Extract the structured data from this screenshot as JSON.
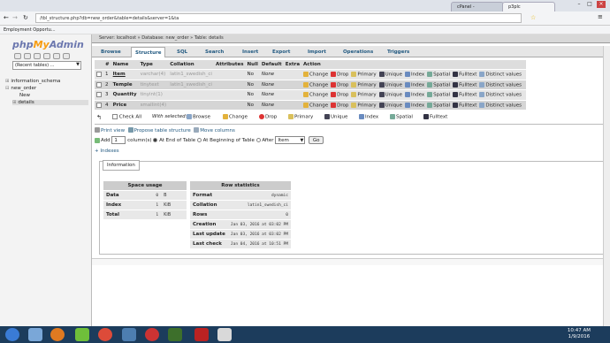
{
  "browser": {
    "tabs": [
      {
        "label": "cPanel -"
      },
      {
        "label": "p3plc"
      }
    ],
    "url": "/tbl_structure.php?db=new_order&table=details&server=1&ta",
    "bookmark": "Employment Opportu..."
  },
  "sidebar": {
    "logo": {
      "php": "php",
      "my": "My",
      "admin": "Admin"
    },
    "recent": "(Recent tables) ...",
    "tree": [
      "information_schema",
      "new_order",
      "New",
      "details"
    ]
  },
  "breadcrumb": [
    "Server: localhost",
    "Database: new_order",
    "Table: details"
  ],
  "tabs": [
    "Browse",
    "Structure",
    "SQL",
    "Search",
    "Insert",
    "Export",
    "Import",
    "Operations",
    "Triggers"
  ],
  "structure": {
    "headers": [
      "#",
      "Name",
      "Type",
      "Collation",
      "Attributes",
      "Null",
      "Default",
      "Extra",
      "Action"
    ],
    "rows": [
      {
        "num": "1",
        "name": "Item",
        "type": "varchar(4)",
        "collation": "latin1_swedish_ci",
        "attributes": "",
        "null": "No",
        "default": "None",
        "extra": ""
      },
      {
        "num": "2",
        "name": "Temple",
        "type": "tinytext",
        "collation": "latin1_swedish_ci",
        "attributes": "",
        "null": "No",
        "default": "None",
        "extra": ""
      },
      {
        "num": "3",
        "name": "Quantity",
        "type": "tinyint(1)",
        "collation": "",
        "attributes": "",
        "null": "No",
        "default": "None",
        "extra": ""
      },
      {
        "num": "4",
        "name": "Price",
        "type": "smallint(4)",
        "collation": "",
        "attributes": "",
        "null": "No",
        "default": "None",
        "extra": ""
      }
    ],
    "actions": [
      "Change",
      "Drop",
      "Primary",
      "Unique",
      "Index",
      "Spatial",
      "Fulltext",
      "Distinct values"
    ]
  },
  "with_selected": {
    "check_all": "Check All",
    "label": "With selected:",
    "actions": [
      "Browse",
      "Change",
      "Drop",
      "Primary",
      "Unique",
      "Index",
      "Spatial",
      "Fulltext"
    ]
  },
  "links": {
    "print": "Print view",
    "propose": "Propose table structure",
    "move": "Move columns"
  },
  "add": {
    "label": "Add",
    "count": "1",
    "columns": "column(s)",
    "end": "At End of Table",
    "begin": "At Beginning of Table",
    "after": "After",
    "after_col": "Item",
    "go": "Go"
  },
  "indexes": "+ Indexes",
  "info": {
    "legend": "Information",
    "space": {
      "title": "Space usage",
      "rows": [
        {
          "label": "Data",
          "value": "0",
          "unit": "B"
        },
        {
          "label": "Index",
          "value": "1",
          "unit": "KiB"
        },
        {
          "label": "Total",
          "value": "1",
          "unit": "KiB"
        }
      ]
    },
    "stats": {
      "title": "Row statistics",
      "rows": [
        {
          "label": "Format",
          "value": "dynamic"
        },
        {
          "label": "Collation",
          "value": "latin1_swedish_ci"
        },
        {
          "label": "Rows",
          "value": "0"
        },
        {
          "label": "Creation",
          "value": "Jan 03, 2016 at 03:02 PM"
        },
        {
          "label": "Last update",
          "value": "Jan 03, 2016 at 03:02 PM"
        },
        {
          "label": "Last check",
          "value": "Jan 04, 2016 at 10:51 PM"
        }
      ]
    }
  },
  "taskbar": {
    "time": "10:47 AM",
    "date": "1/9/2016"
  }
}
